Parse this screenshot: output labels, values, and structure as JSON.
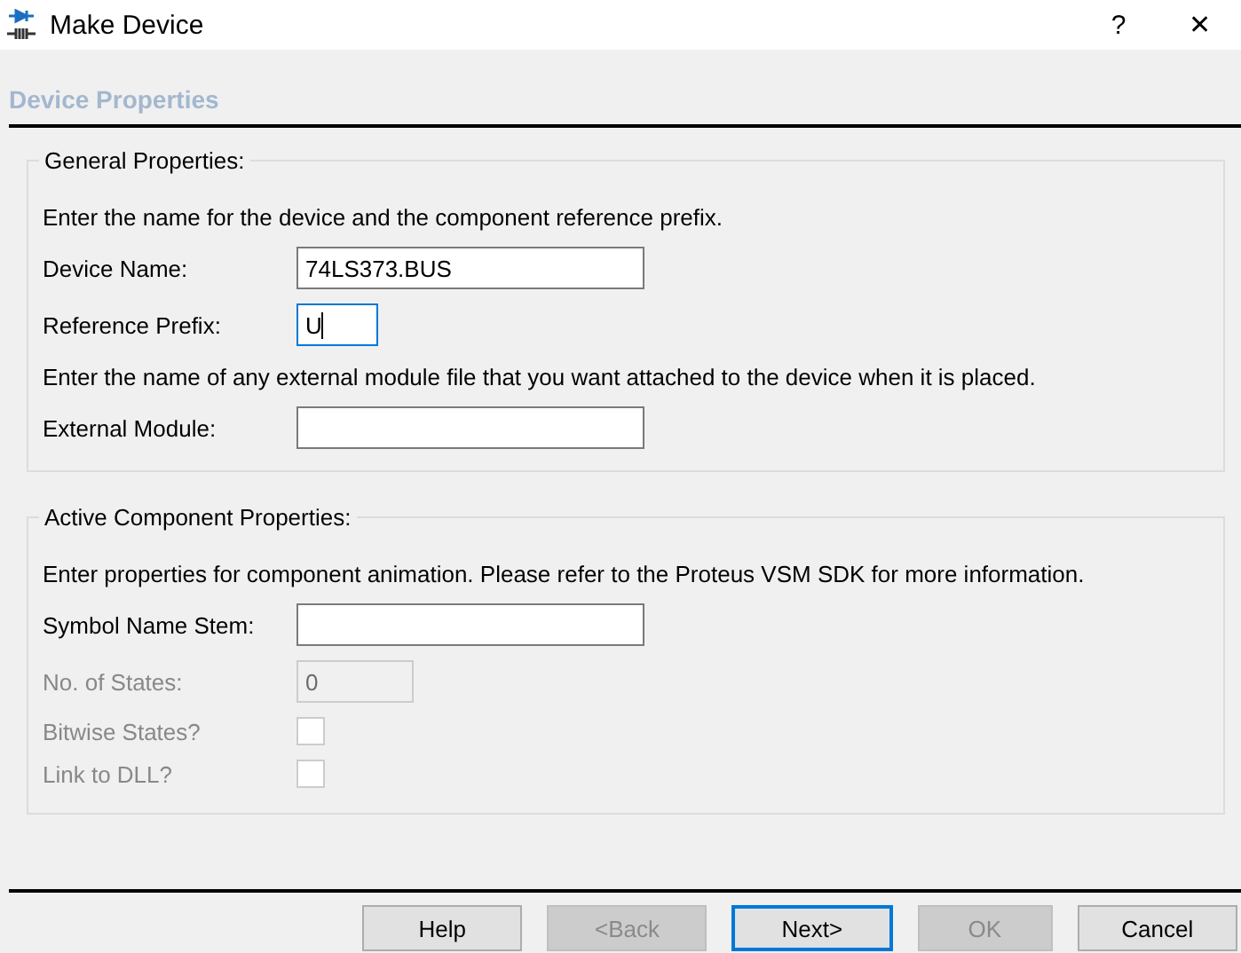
{
  "window": {
    "title": "Make Device",
    "help": "?",
    "close": "✕"
  },
  "page_title": "Device Properties",
  "groups": [
    {
      "title": "General Properties:",
      "rows": [
        {
          "kind": "text",
          "text": "Enter the name for the device and the component reference prefix."
        },
        {
          "kind": "wide_field",
          "label": "Device Name:",
          "value": "74LS373.BUS",
          "focused": false,
          "disabled": false
        },
        {
          "kind": "short_field",
          "label": "Reference Prefix:",
          "value": "U",
          "focused": true,
          "disabled": false
        },
        {
          "kind": "text",
          "text": "Enter the name of any external module file that you want attached to the device when it is placed."
        },
        {
          "kind": "wide_field",
          "label": "External Module:",
          "value": "",
          "focused": false,
          "disabled": false
        }
      ]
    },
    {
      "title": "Active Component Properties:",
      "rows": [
        {
          "kind": "text",
          "text": "Enter properties for component animation. Please refer to the Proteus VSM SDK for more information."
        },
        {
          "kind": "wide_field",
          "label": "Symbol Name Stem:",
          "value": "",
          "focused": false,
          "disabled": false
        },
        {
          "kind": "mid_field",
          "label": "No. of States:",
          "value": "0",
          "focused": false,
          "disabled": true
        },
        {
          "kind": "check",
          "label": "Bitwise States?",
          "checked": false,
          "disabled": true
        },
        {
          "kind": "check",
          "label": "Link to DLL?",
          "checked": false,
          "disabled": true
        }
      ]
    }
  ],
  "buttons": [
    {
      "label": "Help",
      "disabled": false,
      "focused": false
    },
    {
      "label": "<Back",
      "disabled": true,
      "focused": false
    },
    {
      "label": "Next>",
      "disabled": false,
      "focused": true
    },
    {
      "label": "OK",
      "disabled": true,
      "focused": false
    },
    {
      "label": "Cancel",
      "disabled": false,
      "focused": false
    }
  ]
}
